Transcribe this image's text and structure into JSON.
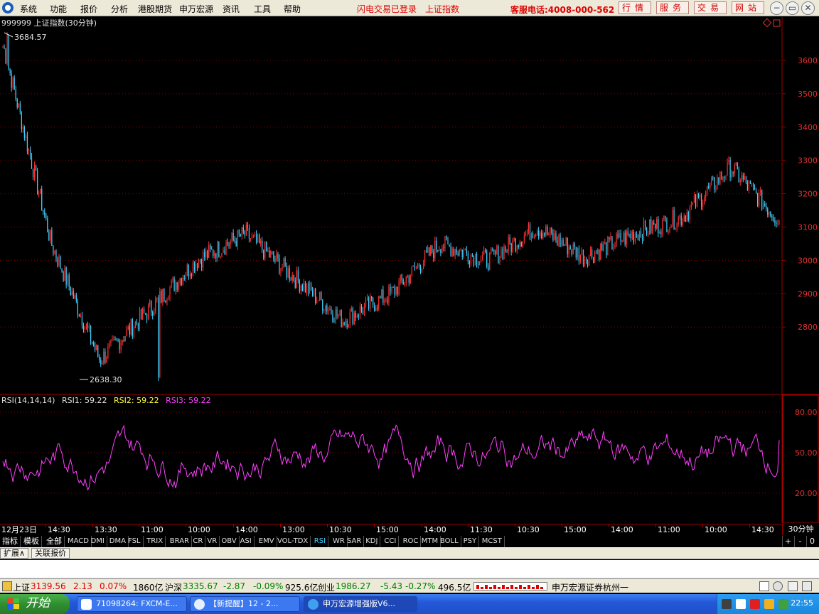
{
  "menubar": {
    "items": [
      "系统",
      "功能",
      "报价",
      "分析",
      "港股期货",
      "申万宏源",
      "资讯",
      "工具",
      "帮助"
    ],
    "login_status": "闪电交易已登录",
    "current_index": "上证指数",
    "hotline": "客服电话:4008-000-562",
    "nav_buttons": [
      "行情",
      "服务",
      "交易",
      "网站"
    ],
    "window_buttons": [
      "−",
      "▭",
      "✕"
    ]
  },
  "chart": {
    "header": "999999 上证指数(30分钟)",
    "high_label": "3684.57",
    "low_label": "2638.30",
    "y_ticks": [
      "3600",
      "3500",
      "3400",
      "3300",
      "3200",
      "3100",
      "3000",
      "2900",
      "2800"
    ],
    "rsi_header": {
      "title": "RSI(14,14,14)",
      "rsi1": "RSI1: 59.22",
      "rsi2": "RSI2: 59.22",
      "rsi3": "RSI3: 59.22"
    },
    "rsi_ticks": [
      "80.00",
      "50.00",
      "20.00"
    ],
    "x_labels": [
      "12月23日",
      "14:30",
      "13:30",
      "11:00",
      "10:00",
      "14:00",
      "13:00",
      "10:30",
      "15:00",
      "14:00",
      "11:30",
      "10:30",
      "15:00",
      "14:00",
      "11:00",
      "10:00",
      "14:30"
    ],
    "period": "30分钟"
  },
  "chart_data": [
    {
      "type": "candlestick",
      "title": "999999 上证指数(30分钟)",
      "ylim": [
        2638.3,
        3684.57
      ],
      "y_ticks": [
        2800,
        2900,
        3000,
        3100,
        3200,
        3300,
        3400,
        3500,
        3600
      ],
      "max": 3684.57,
      "min": 2638.3,
      "approx_path": [
        {
          "x": "12月23日",
          "y": 3650
        },
        {
          "x": "14:30",
          "y": 3050
        },
        {
          "x": "13:30",
          "y": 2700
        },
        {
          "x": "11:00",
          "y": 2850
        },
        {
          "x": "10:00",
          "y": 3000
        },
        {
          "x": "14:00",
          "y": 3080
        },
        {
          "x": "13:00",
          "y": 2950
        },
        {
          "x": "10:30",
          "y": 2820
        },
        {
          "x": "15:00",
          "y": 2900
        },
        {
          "x": "14:00",
          "y": 3050
        },
        {
          "x": "11:30",
          "y": 3000
        },
        {
          "x": "10:30",
          "y": 3100
        },
        {
          "x": "15:00",
          "y": 3010
        },
        {
          "x": "14:00",
          "y": 3080
        },
        {
          "x": "11:00",
          "y": 3130
        },
        {
          "x": "10:00",
          "y": 3280
        },
        {
          "x": "14:30",
          "y": 3120
        }
      ]
    },
    {
      "type": "line",
      "title": "RSI(14,14,14)",
      "ylim": [
        0,
        100
      ],
      "y_ticks": [
        20,
        50,
        80
      ],
      "series": [
        {
          "name": "RSI3",
          "last": 59.22
        }
      ]
    }
  ],
  "tabs": {
    "left": [
      "指标",
      "模板",
      "全部"
    ],
    "indicators": [
      "MACD",
      "DMI",
      "DMA",
      "FSL",
      "TRIX",
      "BRAR",
      "CR",
      "VR",
      "OBV",
      "ASI",
      "EMV",
      "VOL-TDX",
      "RSI",
      "WR",
      "SAR",
      "KDJ",
      "CCI",
      "ROC",
      "MTM",
      "BOLL",
      "PSY",
      "MCST"
    ],
    "active": "RSI",
    "pager": [
      "+",
      "-",
      "0"
    ]
  },
  "expand": {
    "items": [
      "扩展∧",
      "关联报价"
    ]
  },
  "quotes": {
    "sh_label": "上证",
    "sh_value": "3139.56",
    "sh_change": "2.13",
    "sh_pct": "0.07%",
    "sh_vol": "1860亿",
    "hs_label": "沪深",
    "hs_value": "3335.67",
    "hs_change": "-2.87",
    "hs_pct": "-0.09%",
    "hs_vol": "925.6亿",
    "cy_label": "创业",
    "cy_value": "1986.27",
    "cy_change": "-5.43",
    "cy_pct": "-0.27%",
    "cy_vol": "496.5亿",
    "broker": "申万宏源证券杭州一"
  },
  "taskbar": {
    "start": "开始",
    "tasks": [
      "71098264: FXCM-E...",
      "【新提醒】12 - 2...",
      "申万宏源增强版V6..."
    ],
    "clock": "22:55"
  },
  "colors": {
    "up": "#ff3030",
    "down": "#40d0ff",
    "rsi": "#ff40ff",
    "axis": "#a00000"
  }
}
